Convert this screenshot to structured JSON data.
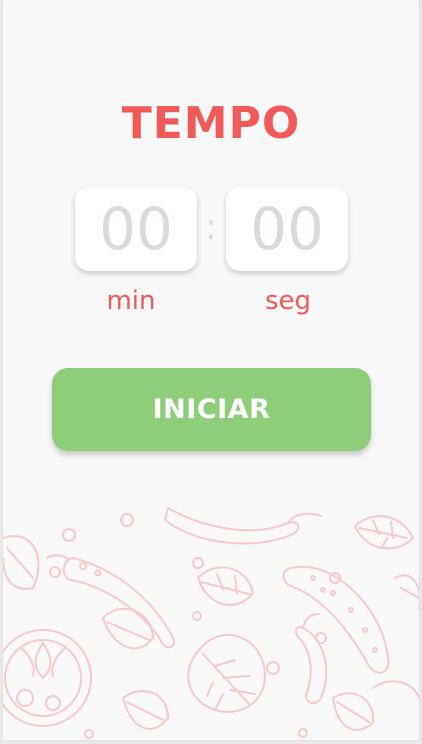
{
  "screen": {
    "title": "TEMPO"
  },
  "timer": {
    "minutes": "00",
    "seconds": "00",
    "separator": ":",
    "min_label": "min",
    "sec_label": "seg"
  },
  "actions": {
    "start_label": "INICIAR"
  },
  "colors": {
    "accent": "#f05a5a",
    "button": "#8ece7a",
    "digits": "#ddd8d8",
    "background": "#f8f8f8",
    "pattern": "#f6c9c9"
  },
  "decor": {
    "pattern_icon": "vegetables-doodle-pattern"
  }
}
